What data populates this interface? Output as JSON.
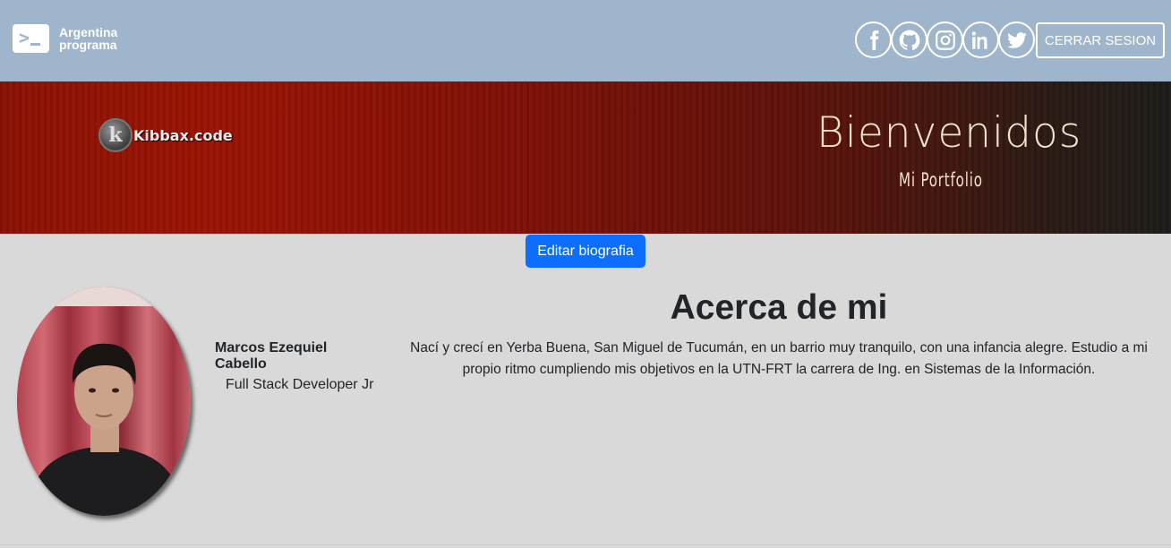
{
  "navbar": {
    "logo_line1": "Argentina",
    "logo_line2": "programa",
    "social": [
      {
        "name": "facebook",
        "icon": "facebook-icon"
      },
      {
        "name": "github",
        "icon": "github-icon"
      },
      {
        "name": "instagram",
        "icon": "instagram-icon"
      },
      {
        "name": "linkedin",
        "icon": "linkedin-icon"
      },
      {
        "name": "twitter",
        "icon": "twitter-icon"
      }
    ],
    "logout_label": "CERRAR SESION"
  },
  "banner": {
    "brand": "Kibbax.code",
    "title": "Bienvenidos",
    "subtitle": "Mi Portfolio"
  },
  "edit_bio_label": "Editar biografia",
  "profile": {
    "name": "Marcos Ezequiel Cabello",
    "role": "Full Stack Developer Jr"
  },
  "about": {
    "title": "Acerca de mi",
    "text": "Nací y crecí en Yerba Buena, San Miguel de Tucumán, en un barrio muy tranquilo, con una infancia alegre. Estudio a mi propio ritmo cumpliendo mis objetivos en la UTN-FRT la carrera de Ing. en Sistemas de la Información."
  },
  "colors": {
    "navbar_bg": "#9fb5cc",
    "banner_red": "#9a1303",
    "banner_dark": "#1d1c19",
    "primary_button": "#0d6efd",
    "page_bg": "#d9d9d9"
  }
}
